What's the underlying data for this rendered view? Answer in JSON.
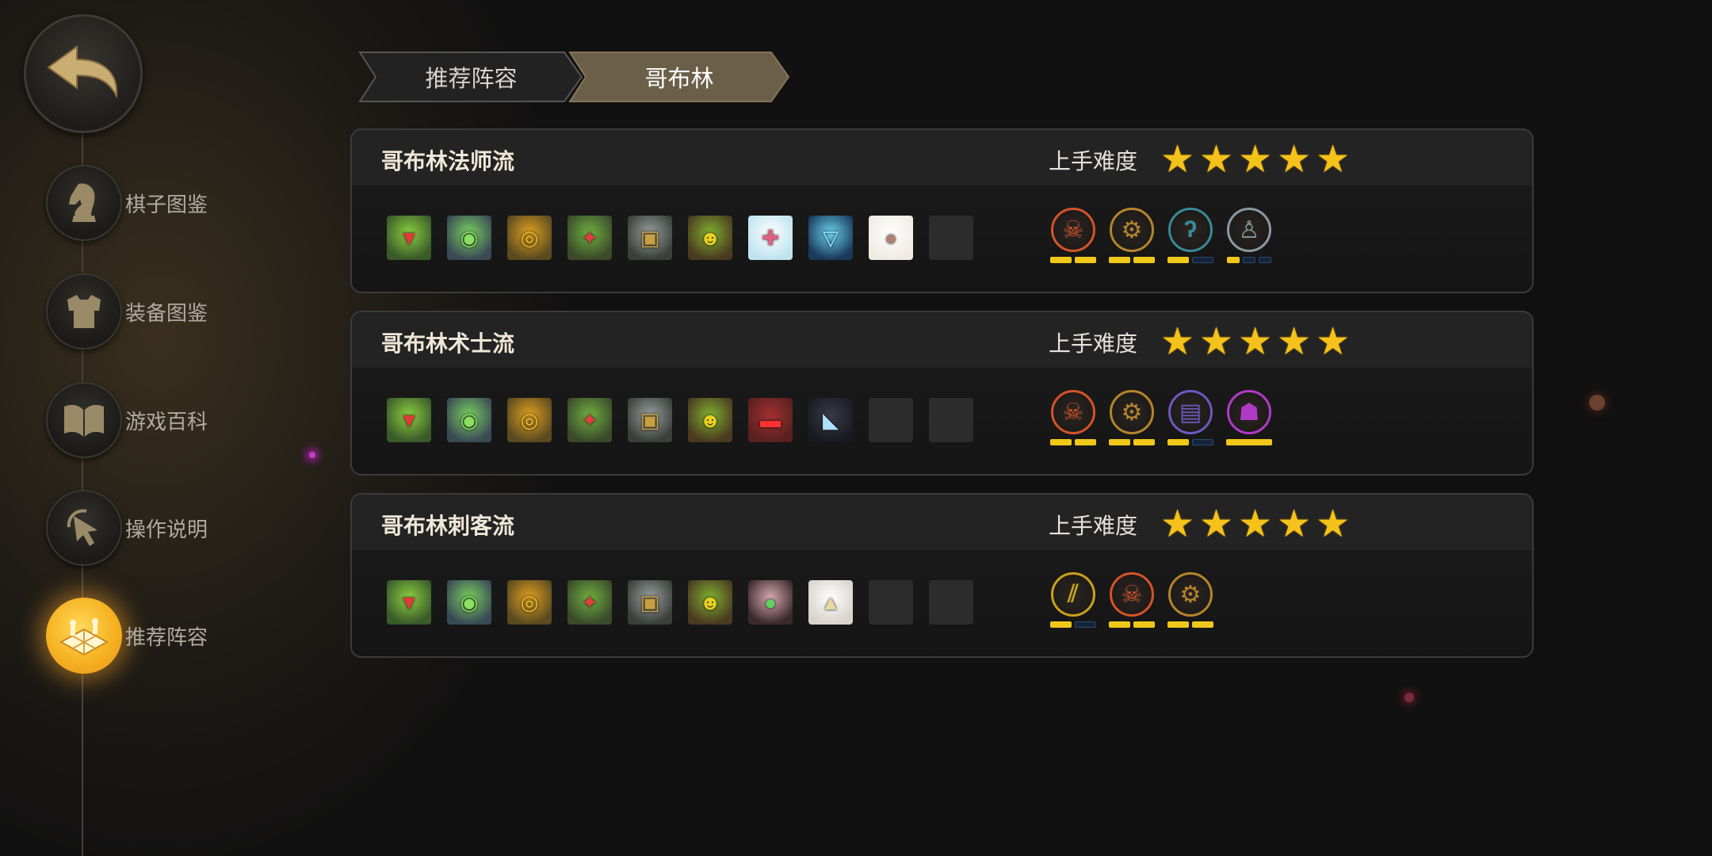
{
  "sidebar": {
    "items": [
      {
        "label": "棋子图鉴",
        "icon": "knight-icon"
      },
      {
        "label": "装备图鉴",
        "icon": "armor-icon"
      },
      {
        "label": "游戏百科",
        "icon": "book-icon"
      },
      {
        "label": "操作说明",
        "icon": "cursor-click-icon"
      },
      {
        "label": "推荐阵容",
        "icon": "chessboard-icon",
        "active": true
      }
    ]
  },
  "tabs": [
    {
      "label": "推荐阵容",
      "active": false
    },
    {
      "label": "哥布林",
      "active": true
    }
  ],
  "lineups": [
    {
      "title": "哥布林法师流",
      "difficulty_label": "上手难度",
      "difficulty_stars": 5,
      "heroes": [
        "goblin-engineer",
        "goblin-robot",
        "goblin-goggles",
        "goblin-parrot",
        "goblin-chest",
        "goblin-shaman",
        "frost-bear",
        "blue-shield",
        "sheep",
        "empty"
      ],
      "synergies": [
        {
          "icon": "goblin-race-icon",
          "color": "#d4532a",
          "bars": [
            1,
            1
          ]
        },
        {
          "icon": "mech-gear-icon",
          "color": "#b5852a",
          "bars": [
            1,
            1
          ]
        },
        {
          "icon": "mage-staff-icon",
          "color": "#3a8a9a",
          "bars": [
            1,
            0
          ]
        },
        {
          "icon": "priest-icon",
          "color": "#8a9aa0",
          "bars": [
            1,
            0,
            0
          ]
        }
      ]
    },
    {
      "title": "哥布林术士流",
      "difficulty_label": "上手难度",
      "difficulty_stars": 5,
      "heroes": [
        "goblin-engineer",
        "goblin-robot",
        "goblin-goggles",
        "goblin-parrot",
        "goblin-chest",
        "goblin-shaman",
        "red-demon",
        "shadow-hood",
        "empty",
        "empty"
      ],
      "synergies": [
        {
          "icon": "goblin-race-icon",
          "color": "#d4532a",
          "bars": [
            1,
            1
          ]
        },
        {
          "icon": "mech-gear-icon",
          "color": "#b5852a",
          "bars": [
            1,
            1
          ]
        },
        {
          "icon": "warlock-book-icon",
          "color": "#6a5ac0",
          "bars": [
            1,
            0
          ]
        },
        {
          "icon": "demon-icon",
          "color": "#b03ac8",
          "bars": [
            1
          ]
        }
      ]
    },
    {
      "title": "哥布林刺客流",
      "difficulty_label": "上手难度",
      "difficulty_stars": 5,
      "heroes": [
        "goblin-engineer",
        "goblin-robot",
        "goblin-goggles",
        "goblin-parrot",
        "goblin-chest",
        "goblin-shaman",
        "horned-ogre",
        "wizard-hat",
        "empty",
        "empty"
      ],
      "synergies": [
        {
          "icon": "assassin-blades-icon",
          "color": "#c8a21a",
          "bars": [
            1,
            0
          ]
        },
        {
          "icon": "goblin-race-icon",
          "color": "#d4532a",
          "bars": [
            1,
            1
          ]
        },
        {
          "icon": "mech-gear-icon",
          "color": "#b5852a",
          "bars": [
            1,
            1
          ]
        }
      ]
    }
  ]
}
